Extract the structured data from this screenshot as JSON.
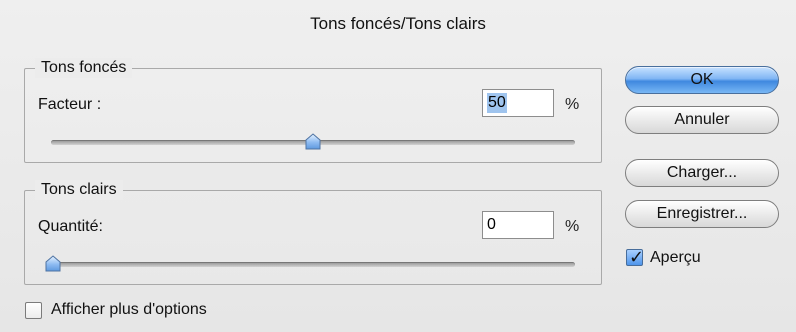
{
  "window": {
    "title": "Tons foncés/Tons clairs"
  },
  "shadows": {
    "group_label": "Tons foncés",
    "field_label": "Facteur :",
    "value": "50",
    "unit": "%",
    "slider_level_percent": 50
  },
  "highlights": {
    "group_label": "Tons clairs",
    "field_label": "Quantité:",
    "value": "0",
    "unit": "%",
    "slider_level_percent": 0
  },
  "buttons": {
    "ok_label": "OK",
    "cancel_label": "Annuler",
    "load_label": "Charger...",
    "save_label": "Enregistrer..."
  },
  "preview": {
    "label": "Aperçu",
    "checked": true
  },
  "options": {
    "label": "Afficher plus d'options",
    "checked": false
  },
  "icons": {
    "slider_thumb": "slider-thumb-icon",
    "checkmark": "checkmark-icon"
  },
  "colors": {
    "dialog_background": "#ececec",
    "accent": "#3f88df",
    "selection": "#9fc4ee"
  }
}
